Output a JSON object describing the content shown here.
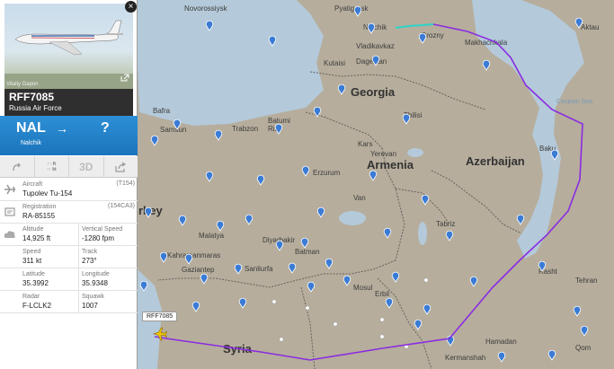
{
  "panel": {
    "photo_credit": "Vitaliy Gapon",
    "callsign": "RFF7085",
    "operator": "Russia Air Force",
    "route": {
      "from": "NAL",
      "arrow": "→",
      "to": "?",
      "from_name": "Nalchik"
    },
    "toolbar": {
      "mid_label_top": "↑↑ ft",
      "mid_label_bottom": "↑↑ kt",
      "three_d": "3D"
    },
    "info": {
      "aircraft_label": "Aircraft",
      "aircraft_code": "(T154)",
      "aircraft_value": "Tupolev Tu-154",
      "registration_label": "Registration",
      "registration_code": "(154CA3)",
      "registration_value": "RA-85155",
      "altitude_label": "Altitude",
      "altitude_value": "14,925 ft",
      "vspeed_label": "Vertical Speed",
      "vspeed_value": "-1280 fpm",
      "speed_label": "Speed",
      "speed_value": "311 kt",
      "track_label": "Track",
      "track_value": "273°",
      "lat_label": "Latitude",
      "lat_value": "35.3992",
      "lon_label": "Longitude",
      "lon_value": "35.9348",
      "radar_label": "Radar",
      "radar_value": "F-LCLK2",
      "squawk_label": "Squawk",
      "squawk_value": "1007"
    },
    "colors": {
      "header_blue": "#1f7ec4",
      "track_purple": "#8a2be2",
      "track_cyan": "#2bd4c8",
      "airport_blue": "#3a7bd5"
    }
  },
  "map": {
    "flight_tag": "RFF7085",
    "countries": [
      "Georgia",
      "Armenia",
      "Azerbaijan",
      "Syria",
      "rkey"
    ],
    "sea_label": "Caspian Sea",
    "places": [
      "Novorossiysk",
      "Pyatigorsk",
      "Nalchik",
      "Grozny",
      "Vladikavkaz",
      "Dagestan",
      "Makhachkala",
      "Aktau",
      "Kutaisi",
      "Tbilisi",
      "Batumi",
      "Rize",
      "Trabzon",
      "Samsun",
      "Bafra",
      "Kars",
      "Yerevan",
      "Baku",
      "Tabriz",
      "Rasht",
      "Tehran",
      "Qom",
      "Hamadan",
      "Kermanshah",
      "Erbil",
      "Mosul",
      "Diyarbakir",
      "Batman",
      "Sanliurfa",
      "Gaziantep",
      "Kahramanmaras",
      "Malatya",
      "Erzurum",
      "Van"
    ]
  }
}
